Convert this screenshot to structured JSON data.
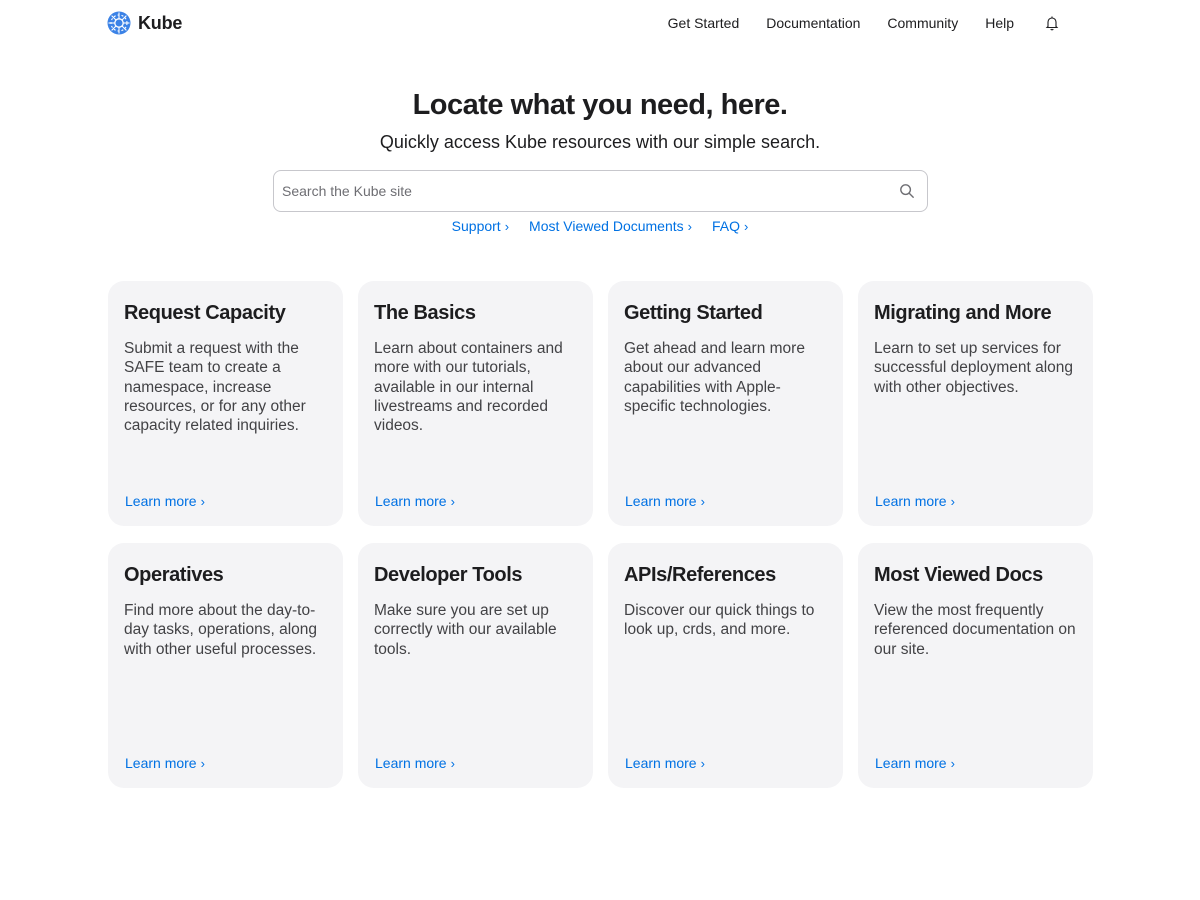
{
  "header": {
    "brand": {
      "name": "Kube",
      "logo_icon": "kube-logo-icon",
      "logo_color": "#3b82e6"
    },
    "nav": [
      {
        "label": "Get Started"
      },
      {
        "label": "Documentation"
      },
      {
        "label": "Community"
      },
      {
        "label": "Help"
      }
    ],
    "notification_icon": "bell-icon"
  },
  "hero": {
    "title": "Locate what you need, here.",
    "subtitle": "Quickly access Kube resources with our simple search."
  },
  "search": {
    "placeholder": "Search the Kube site",
    "value": "",
    "icon": "search-icon"
  },
  "quick_links": [
    {
      "label": "Support"
    },
    {
      "label": "Most Viewed Documents"
    },
    {
      "label": "FAQ"
    }
  ],
  "cards": [
    {
      "title": "Request Capacity",
      "description": "Submit a request with the SAFE team to create a namespace, increase resources, or for any other capacity related inquiries.",
      "link": "Learn more"
    },
    {
      "title": "The Basics",
      "description": "Learn about containers and more with our tutorials, available in our internal livestreams and recorded videos.",
      "link": "Learn more"
    },
    {
      "title": "Getting Started",
      "description": "Get ahead and learn more about our advanced capabilities with Apple-specific technologies.",
      "link": "Learn more"
    },
    {
      "title": "Migrating and More",
      "description": "Learn to set up services for successful deployment along with other objectives.",
      "link": "Learn more"
    },
    {
      "title": "Operatives",
      "description": "Find more about the day-to-day tasks, operations, along with other useful processes.",
      "link": "Learn more"
    },
    {
      "title": "Developer Tools",
      "description": "Make sure you are set up correctly with our available tools.",
      "link": "Learn more"
    },
    {
      "title": "APIs/References",
      "description": "Discover our quick things to look up, crds, and more.",
      "link": "Learn more"
    },
    {
      "title": "Most Viewed Docs",
      "description": "View the most frequently referenced documentation on our site.",
      "link": "Learn more"
    }
  ],
  "colors": {
    "accent": "#0071e3",
    "card_background": "#f4f4f6",
    "text": "#1d1d1f"
  }
}
